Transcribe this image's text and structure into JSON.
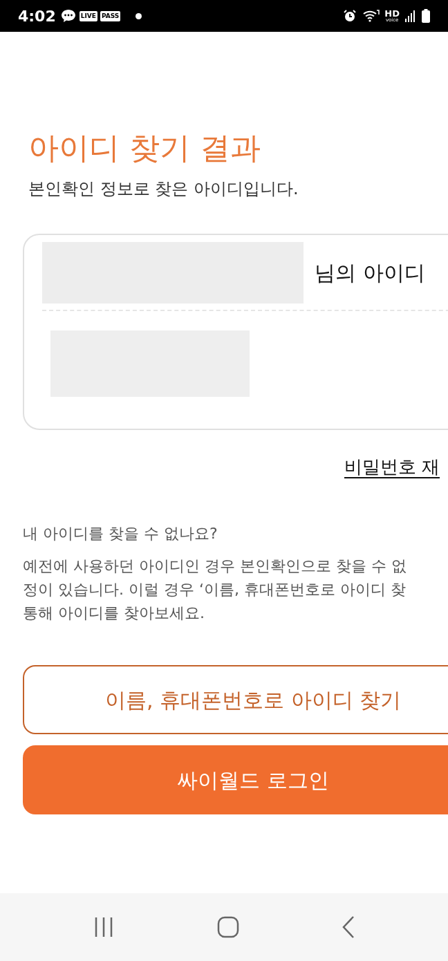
{
  "status_bar": {
    "time": "4:02",
    "badges": [
      "LIVE",
      "PASS"
    ],
    "network": [
      "HD",
      "voice"
    ]
  },
  "title": "아이디 찾기 결과",
  "subtitle": "본인확인 정보로 찾은 아이디입니다.",
  "result_card": {
    "label": "님의 아이디"
  },
  "reset_password_link": "비밀번호 재",
  "help": {
    "question": "내 아이디를 찾을 수 없나요?",
    "lines": [
      "예전에 사용하던 아이디인 경우 본인확인으로 찾을 수 없",
      "정이 있습니다. 이럴 경우 ‘이름, 휴대폰번호로 아이디 찾",
      "통해 아이디를 찾아보세요."
    ]
  },
  "buttons": [
    {
      "kind": "outline",
      "label": "이름, 휴대폰번호로 아이디 찾기"
    },
    {
      "kind": "filled",
      "label": "싸이월드 로그인"
    }
  ]
}
